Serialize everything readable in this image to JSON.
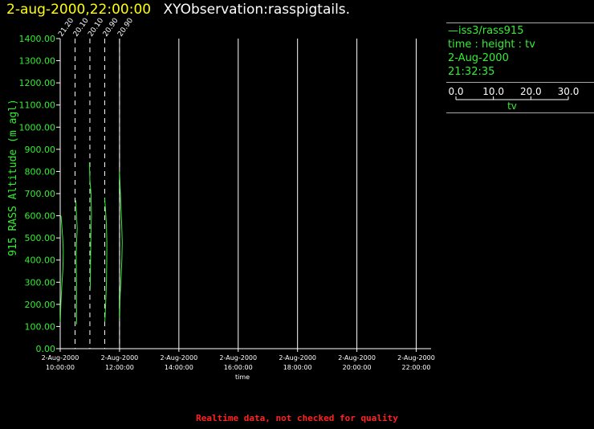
{
  "header": {
    "date_time": "2-aug-2000,22:00:00",
    "observation": "XYObservation:rasspigtails."
  },
  "legend": {
    "station": "iss3/rass915",
    "variables": "time : height : tv",
    "date": "2-Aug-2000",
    "time": "21:32:35",
    "scale_ticks": [
      "0.0",
      "10.0",
      "20.0",
      "30.0"
    ],
    "scale_label": "tv"
  },
  "footer": "Realtime data, not checked for quality",
  "colors": {
    "trace": "#33ee33",
    "axis_labels": "#33ee33",
    "gridline": "#ffffff",
    "header_date": "#ffff00",
    "footer": "#ff2222"
  },
  "chart_data": {
    "type": "line",
    "xlabel": "time",
    "ylabel": "915 RASS Altitude (m agl)",
    "ylim": [
      0,
      1400
    ],
    "y_ticks": [
      "0.00",
      "100.00",
      "200.00",
      "300.00",
      "400.00",
      "500.00",
      "600.00",
      "700.00",
      "800.00",
      "900.00",
      "1000.00",
      "1100.00",
      "1200.00",
      "1300.00",
      "1400.00"
    ],
    "x_range_hours": [
      10,
      22.5
    ],
    "x_ticks": [
      {
        "hour": 10,
        "date": "2-Aug-2000",
        "time": "10:00:00"
      },
      {
        "hour": 12,
        "date": "2-Aug-2000",
        "time": "12:00:00"
      },
      {
        "hour": 14,
        "date": "2-Aug-2000",
        "time": "14:00:00"
      },
      {
        "hour": 16,
        "date": "2-Aug-2000",
        "time": "16:00:00"
      },
      {
        "hour": 18,
        "date": "2-Aug-2000",
        "time": "18:00:00"
      },
      {
        "hour": 20,
        "date": "2-Aug-2000",
        "time": "20:00:00"
      },
      {
        "hour": 22,
        "date": "2-Aug-2000",
        "time": "22:00:00"
      }
    ],
    "tv_scale_hours_per_unit": 0.026,
    "pigtails": [
      {
        "base_hour": 10.0,
        "label": "21.20",
        "points": [
          [
            0.2,
            120
          ],
          [
            0.8,
            200
          ],
          [
            2,
            280
          ],
          [
            3.5,
            360
          ],
          [
            4,
            440
          ],
          [
            3.2,
            500
          ],
          [
            2,
            560
          ],
          [
            1,
            600
          ]
        ]
      },
      {
        "base_hour": 10.5,
        "label": "20.10",
        "points": [
          [
            2,
            110
          ],
          [
            2,
            300
          ],
          [
            1.5,
            420
          ],
          [
            2.2,
            500
          ],
          [
            2.8,
            540
          ],
          [
            2,
            600
          ],
          [
            1,
            670
          ]
        ]
      },
      {
        "base_hour": 11.0,
        "label": "20.10",
        "points": [
          [
            0.5,
            270
          ],
          [
            1,
            420
          ],
          [
            1.4,
            520
          ],
          [
            2,
            600
          ],
          [
            1.5,
            700
          ],
          [
            0,
            760
          ],
          [
            -0.6,
            840
          ]
        ]
      },
      {
        "base_hour": 11.5,
        "label": "20.90",
        "points": [
          [
            0.2,
            120
          ],
          [
            1.2,
            200
          ],
          [
            2.2,
            300
          ],
          [
            2.7,
            400
          ],
          [
            2.8,
            480
          ],
          [
            2.2,
            560
          ],
          [
            0.8,
            640
          ],
          [
            0,
            680
          ]
        ]
      },
      {
        "base_hour": 12.0,
        "label": "20.90",
        "points": [
          [
            0.2,
            140
          ],
          [
            0.8,
            240
          ],
          [
            2,
            320
          ],
          [
            3,
            400
          ],
          [
            3.5,
            480
          ],
          [
            2.8,
            560
          ],
          [
            1.5,
            660
          ],
          [
            0.5,
            760
          ],
          [
            0,
            800
          ]
        ]
      }
    ]
  }
}
